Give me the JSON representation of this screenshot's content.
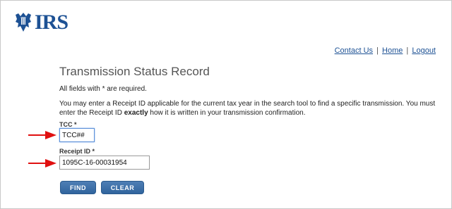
{
  "header": {
    "logo_text": "IRS",
    "logo_icon": "eagle-seal-icon",
    "brand_color": "#1d5194"
  },
  "topnav": {
    "contact_label": "Contact Us",
    "separator": "|",
    "home_label": "Home",
    "logout_label": "Logout"
  },
  "page": {
    "title": "Transmission Status Record",
    "required_note": "All fields with * are required.",
    "description_part1": "You may enter a Receipt ID applicable for the current tax year in the search tool to find a specific transmission. You must enter the Receipt ID ",
    "description_bold": "exactly",
    "description_part2": " how it is written in your transmission confirmation."
  },
  "form": {
    "tcc_label": "TCC *",
    "tcc_value": "TCC##",
    "receipt_label": "Receipt ID *",
    "receipt_value": "1095C-16-00031954"
  },
  "buttons": {
    "find_label": "FIND",
    "clear_label": "CLEAR",
    "button_color": "#30649d"
  },
  "annotations": {
    "arrow_color": "#e01010",
    "arrow_icon": "red-arrow-icon"
  }
}
